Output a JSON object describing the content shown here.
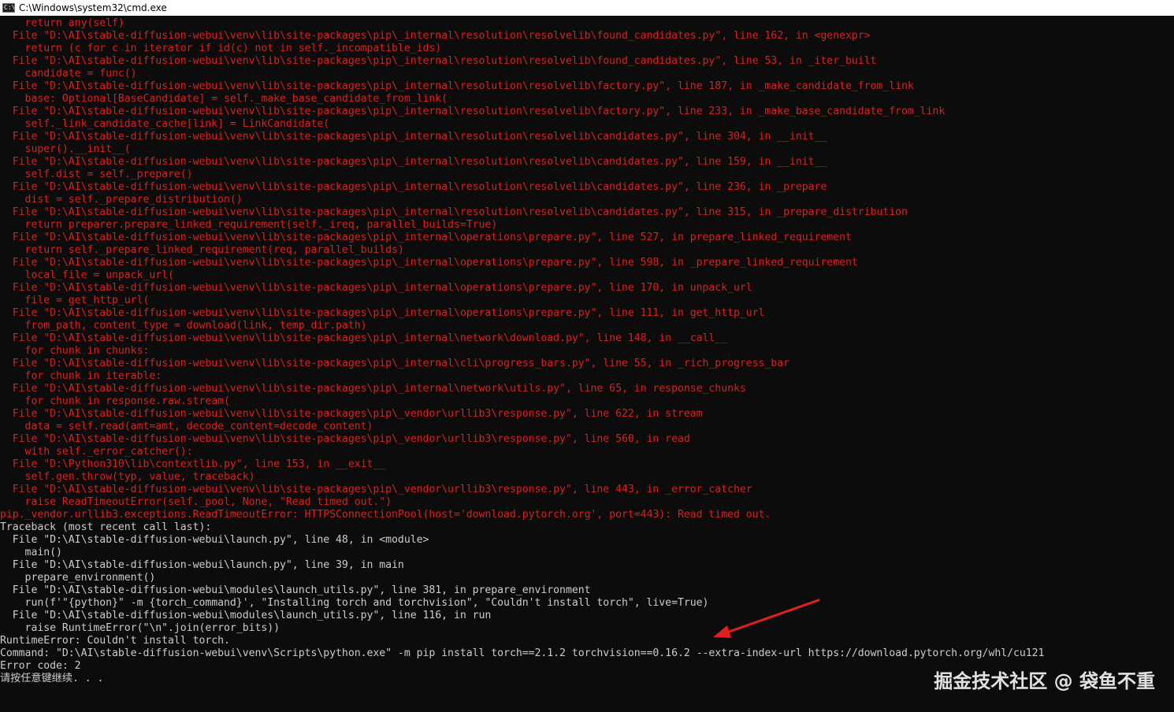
{
  "window": {
    "title": "C:\\Windows\\system32\\cmd.exe",
    "icon_name": "cmd-app-icon",
    "icon_glyph": "C:\\"
  },
  "console": {
    "colors": {
      "background": "#0c0c0c",
      "error_text": "#d7221f",
      "normal_text": "#cccccc",
      "arrow": "#e02020"
    },
    "lines": [
      {
        "text": "    return any(self)",
        "color": "red"
      },
      {
        "text": "  File \"D:\\AI\\stable-diffusion-webui\\venv\\lib\\site-packages\\pip\\_internal\\resolution\\resolvelib\\found_candidates.py\", line 162, in <genexpr>",
        "color": "red"
      },
      {
        "text": "    return (c for c in iterator if id(c) not in self._incompatible_ids)",
        "color": "red"
      },
      {
        "text": "  File \"D:\\AI\\stable-diffusion-webui\\venv\\lib\\site-packages\\pip\\_internal\\resolution\\resolvelib\\found_candidates.py\", line 53, in _iter_built",
        "color": "red"
      },
      {
        "text": "    candidate = func()",
        "color": "red"
      },
      {
        "text": "  File \"D:\\AI\\stable-diffusion-webui\\venv\\lib\\site-packages\\pip\\_internal\\resolution\\resolvelib\\factory.py\", line 187, in _make_candidate_from_link",
        "color": "red"
      },
      {
        "text": "    base: Optional[BaseCandidate] = self._make_base_candidate_from_link(",
        "color": "red"
      },
      {
        "text": "  File \"D:\\AI\\stable-diffusion-webui\\venv\\lib\\site-packages\\pip\\_internal\\resolution\\resolvelib\\factory.py\", line 233, in _make_base_candidate_from_link",
        "color": "red"
      },
      {
        "text": "    self._link_candidate_cache[link] = LinkCandidate(",
        "color": "red"
      },
      {
        "text": "  File \"D:\\AI\\stable-diffusion-webui\\venv\\lib\\site-packages\\pip\\_internal\\resolution\\resolvelib\\candidates.py\", line 304, in __init__",
        "color": "red"
      },
      {
        "text": "    super().__init__(",
        "color": "red"
      },
      {
        "text": "  File \"D:\\AI\\stable-diffusion-webui\\venv\\lib\\site-packages\\pip\\_internal\\resolution\\resolvelib\\candidates.py\", line 159, in __init__",
        "color": "red"
      },
      {
        "text": "    self.dist = self._prepare()",
        "color": "red"
      },
      {
        "text": "  File \"D:\\AI\\stable-diffusion-webui\\venv\\lib\\site-packages\\pip\\_internal\\resolution\\resolvelib\\candidates.py\", line 236, in _prepare",
        "color": "red"
      },
      {
        "text": "    dist = self._prepare_distribution()",
        "color": "red"
      },
      {
        "text": "  File \"D:\\AI\\stable-diffusion-webui\\venv\\lib\\site-packages\\pip\\_internal\\resolution\\resolvelib\\candidates.py\", line 315, in _prepare_distribution",
        "color": "red"
      },
      {
        "text": "    return preparer.prepare_linked_requirement(self._ireq, parallel_builds=True)",
        "color": "red"
      },
      {
        "text": "  File \"D:\\AI\\stable-diffusion-webui\\venv\\lib\\site-packages\\pip\\_internal\\operations\\prepare.py\", line 527, in prepare_linked_requirement",
        "color": "red"
      },
      {
        "text": "    return self._prepare_linked_requirement(req, parallel_builds)",
        "color": "red"
      },
      {
        "text": "  File \"D:\\AI\\stable-diffusion-webui\\venv\\lib\\site-packages\\pip\\_internal\\operations\\prepare.py\", line 598, in _prepare_linked_requirement",
        "color": "red"
      },
      {
        "text": "    local_file = unpack_url(",
        "color": "red"
      },
      {
        "text": "  File \"D:\\AI\\stable-diffusion-webui\\venv\\lib\\site-packages\\pip\\_internal\\operations\\prepare.py\", line 170, in unpack_url",
        "color": "red"
      },
      {
        "text": "    file = get_http_url(",
        "color": "red"
      },
      {
        "text": "  File \"D:\\AI\\stable-diffusion-webui\\venv\\lib\\site-packages\\pip\\_internal\\operations\\prepare.py\", line 111, in get_http_url",
        "color": "red"
      },
      {
        "text": "    from_path, content_type = download(link, temp_dir.path)",
        "color": "red"
      },
      {
        "text": "  File \"D:\\AI\\stable-diffusion-webui\\venv\\lib\\site-packages\\pip\\_internal\\network\\download.py\", line 148, in __call__",
        "color": "red"
      },
      {
        "text": "    for chunk in chunks:",
        "color": "red"
      },
      {
        "text": "  File \"D:\\AI\\stable-diffusion-webui\\venv\\lib\\site-packages\\pip\\_internal\\cli\\progress_bars.py\", line 55, in _rich_progress_bar",
        "color": "red"
      },
      {
        "text": "    for chunk in iterable:",
        "color": "red"
      },
      {
        "text": "  File \"D:\\AI\\stable-diffusion-webui\\venv\\lib\\site-packages\\pip\\_internal\\network\\utils.py\", line 65, in response_chunks",
        "color": "red"
      },
      {
        "text": "    for chunk in response.raw.stream(",
        "color": "red"
      },
      {
        "text": "  File \"D:\\AI\\stable-diffusion-webui\\venv\\lib\\site-packages\\pip\\_vendor\\urllib3\\response.py\", line 622, in stream",
        "color": "red"
      },
      {
        "text": "    data = self.read(amt=amt, decode_content=decode_content)",
        "color": "red"
      },
      {
        "text": "  File \"D:\\AI\\stable-diffusion-webui\\venv\\lib\\site-packages\\pip\\_vendor\\urllib3\\response.py\", line 560, in read",
        "color": "red"
      },
      {
        "text": "    with self._error_catcher():",
        "color": "red"
      },
      {
        "text": "  File \"D:\\Python310\\lib\\contextlib.py\", line 153, in __exit__",
        "color": "red"
      },
      {
        "text": "    self.gen.throw(typ, value, traceback)",
        "color": "red"
      },
      {
        "text": "  File \"D:\\AI\\stable-diffusion-webui\\venv\\lib\\site-packages\\pip\\_vendor\\urllib3\\response.py\", line 443, in _error_catcher",
        "color": "red"
      },
      {
        "text": "    raise ReadTimeoutError(self._pool, None, \"Read timed out.\")",
        "color": "red"
      },
      {
        "text": "pip._vendor.urllib3.exceptions.ReadTimeoutError: HTTPSConnectionPool(host='download.pytorch.org', port=443): Read timed out.",
        "color": "red"
      },
      {
        "text": "Traceback (most recent call last):",
        "color": "white"
      },
      {
        "text": "  File \"D:\\AI\\stable-diffusion-webui\\launch.py\", line 48, in <module>",
        "color": "white"
      },
      {
        "text": "    main()",
        "color": "white"
      },
      {
        "text": "  File \"D:\\AI\\stable-diffusion-webui\\launch.py\", line 39, in main",
        "color": "white"
      },
      {
        "text": "    prepare_environment()",
        "color": "white"
      },
      {
        "text": "  File \"D:\\AI\\stable-diffusion-webui\\modules\\launch_utils.py\", line 381, in prepare_environment",
        "color": "white"
      },
      {
        "text": "    run(f'\"{python}\" -m {torch_command}', \"Installing torch and torchvision\", \"Couldn't install torch\", live=True)",
        "color": "white"
      },
      {
        "text": "  File \"D:\\AI\\stable-diffusion-webui\\modules\\launch_utils.py\", line 116, in run",
        "color": "white"
      },
      {
        "text": "    raise RuntimeError(\"\\n\".join(error_bits))",
        "color": "white"
      },
      {
        "text": "RuntimeError: Couldn't install torch.",
        "color": "white"
      },
      {
        "text": "Command: \"D:\\AI\\stable-diffusion-webui\\venv\\Scripts\\python.exe\" -m pip install torch==2.1.2 torchvision==0.16.2 --extra-index-url https://download.pytorch.org/whl/cu121",
        "color": "white"
      },
      {
        "text": "Error code: 2",
        "color": "white"
      },
      {
        "text": "请按任意键继续. . .",
        "color": "white"
      }
    ]
  },
  "annotation": {
    "icon_name": "red-arrow-annotation-icon"
  },
  "watermark": {
    "text": "掘金技术社区 @ 袋鱼不重"
  }
}
